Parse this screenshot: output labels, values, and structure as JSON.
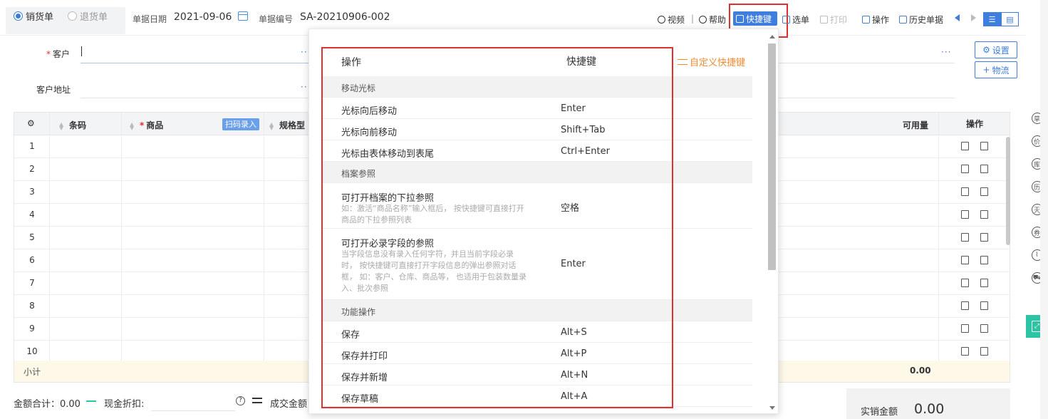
{
  "header": {
    "mode_options": [
      {
        "label": "销货单",
        "checked": true
      },
      {
        "label": "退货单",
        "checked": false
      }
    ],
    "date_label": "单据日期",
    "date_value": "2021-09-06",
    "doc_no_label": "单据编号",
    "doc_no_value": "SA-20210906-002"
  },
  "toolbar": {
    "video": "视频",
    "separator": "|",
    "help": "帮助",
    "hotkey": "快捷键",
    "select": "选单",
    "print": "打印",
    "operate": "操作",
    "history": "历史单据",
    "list_view": "☰",
    "grid_view": "▤"
  },
  "form": {
    "customer_label": "客户",
    "required_mark": "*",
    "address_label": "客户地址",
    "dots": "···",
    "settings_btn": "设置",
    "logistics_btn": "物流"
  },
  "grid": {
    "columns": {
      "barcode": "条码",
      "product": "商品",
      "scan_btn": "扫码录入",
      "spec": "规格型",
      "available": "可用量",
      "actions": "操作"
    },
    "rows": [
      "1",
      "2",
      "3",
      "4",
      "5",
      "6",
      "7",
      "8",
      "9",
      "10"
    ],
    "subtotal_label": "小计",
    "subtotal_value": "0.00"
  },
  "footer": {
    "amount_total": "金额合计：0.00",
    "cash_discount": "现金折扣:",
    "deal_amount": "成交金额",
    "actual_label": "实销金额",
    "actual_value": "0.00"
  },
  "side_tools": [
    {
      "icon": "draft-icon",
      "glyph": "草"
    },
    {
      "icon": "price-icon",
      "glyph": "价"
    },
    {
      "icon": "stock-icon",
      "glyph": "库"
    },
    {
      "icon": "history-icon",
      "glyph": "历"
    },
    {
      "icon": "fire-icon",
      "glyph": "灭"
    },
    {
      "icon": "coupon-icon",
      "glyph": "券"
    },
    {
      "icon": "attachment-icon",
      "glyph": "⌇"
    },
    {
      "icon": "truck-icon",
      "glyph": "⛟"
    },
    {
      "icon": "expand-icon",
      "glyph": "⤢"
    }
  ],
  "hotkey_popup": {
    "col_action": "操作",
    "col_key": "快捷键",
    "custom_link": "自定义快捷键",
    "sections": [
      {
        "title": "移动光标",
        "items": [
          {
            "action": "光标向后移动",
            "key": "Enter"
          },
          {
            "action": "光标向前移动",
            "key": "Shift+Tab"
          },
          {
            "action": "光标由表体移动到表尾",
            "key": "Ctrl+Enter"
          }
        ]
      },
      {
        "title": "档案参照",
        "items": [
          {
            "action": "可打开档案的下拉参照",
            "desc": "如：激活“商品名称”输入框后， 按快捷键可直接打开商品的下拉参照列表",
            "key": "空格"
          },
          {
            "action": "可打开必录字段的参照",
            "desc": "当字段信息没有录入任何字符，并且当前字段必录时， 按快捷键可直接打开字段信息的弹出参照对话框， 如：客户、仓库、商品等， 也适用于包装数量录入、批次参照",
            "key": "Enter"
          }
        ]
      },
      {
        "title": "功能操作",
        "items": [
          {
            "action": "保存",
            "key": "Alt+S"
          },
          {
            "action": "保存并打印",
            "key": "Alt+P"
          },
          {
            "action": "保存并新增",
            "key": "Alt+N"
          },
          {
            "action": "保存草稿",
            "key": "Alt+A"
          }
        ]
      }
    ]
  }
}
